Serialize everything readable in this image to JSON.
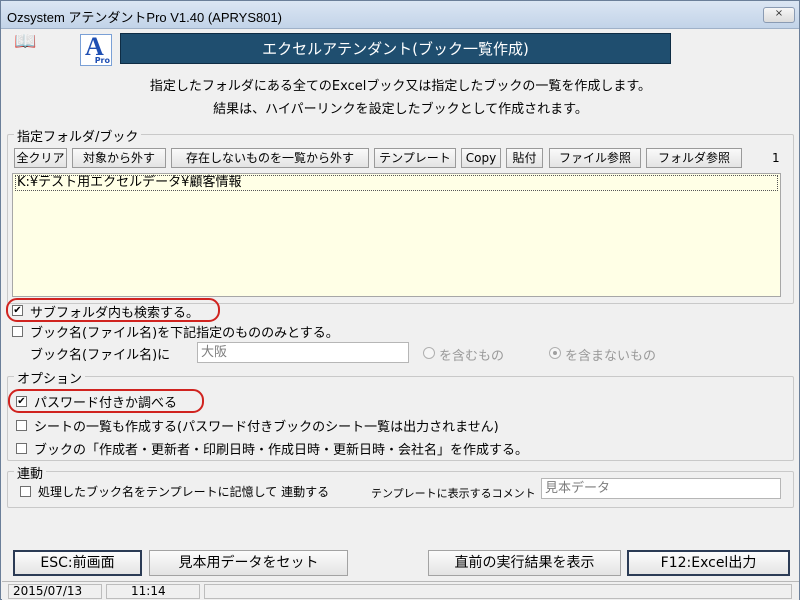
{
  "window": {
    "title": "Ozsystem アテンダントPro V1.40 (APRYS801)",
    "close_label": "×"
  },
  "header": {
    "book_icon": "book-icon",
    "logo_letter": "A",
    "logo_sub": "Pro",
    "banner": "エクセルアテンダント(ブック一覧作成)",
    "desc_line1": "指定したフォルダにある全てのExcelブック又は指定したブックの一覧を作成します。",
    "desc_line2": "結果は、ハイパーリンクを設定したブックとして作成されます。"
  },
  "folder_group": {
    "title": "指定フォルダ/ブック",
    "buttons": [
      "全クリア",
      "対象から外す",
      "存在しないものを一覧から外す",
      "テンプレート",
      "Copy",
      "貼付",
      "ファイル参照",
      "フォルダ参照"
    ],
    "count": "1",
    "items": [
      "K:¥テスト用エクセルデータ¥顧客情報"
    ]
  },
  "options_top": {
    "subfolder_label": "サブフォルダ内も検索する。",
    "subfolder_checked": "✔",
    "bookname_only_label": "ブック名(ファイル名)を下記指定のもののみとする。",
    "bookname_label": "ブック名(ファイル名)に",
    "bookname_value": "大阪",
    "radio_include": "を含むもの",
    "radio_exclude": "を含まないもの"
  },
  "option_group": {
    "title": "オプション",
    "password_label": "パスワード付きか調べる",
    "password_checked": "✔",
    "sheet_list_label": "シートの一覧も作成する(パスワード付きブックのシート一覧は出力されません)",
    "props_label": "ブックの「作成者・更新者・印刷日時・作成日時・更新日時・会社名」を作成する。"
  },
  "link_group": {
    "title": "連動",
    "remember_label": "処理したブック名をテンプレートに記憶して 連動する",
    "comment_label": "テンプレートに表示するコメント",
    "comment_value": "見本データ"
  },
  "bottom_buttons": {
    "esc": "ESC:前画面",
    "sample": "見本用データをセット",
    "prev_result": "直前の実行結果を表示",
    "f12": "F12:Excel出力"
  },
  "status": {
    "date": "2015/07/13",
    "time": "11:14"
  },
  "colors": {
    "banner_bg": "#1f4e6f",
    "highlight_ring": "#d0231f",
    "list_bg": "#ffffe6"
  }
}
